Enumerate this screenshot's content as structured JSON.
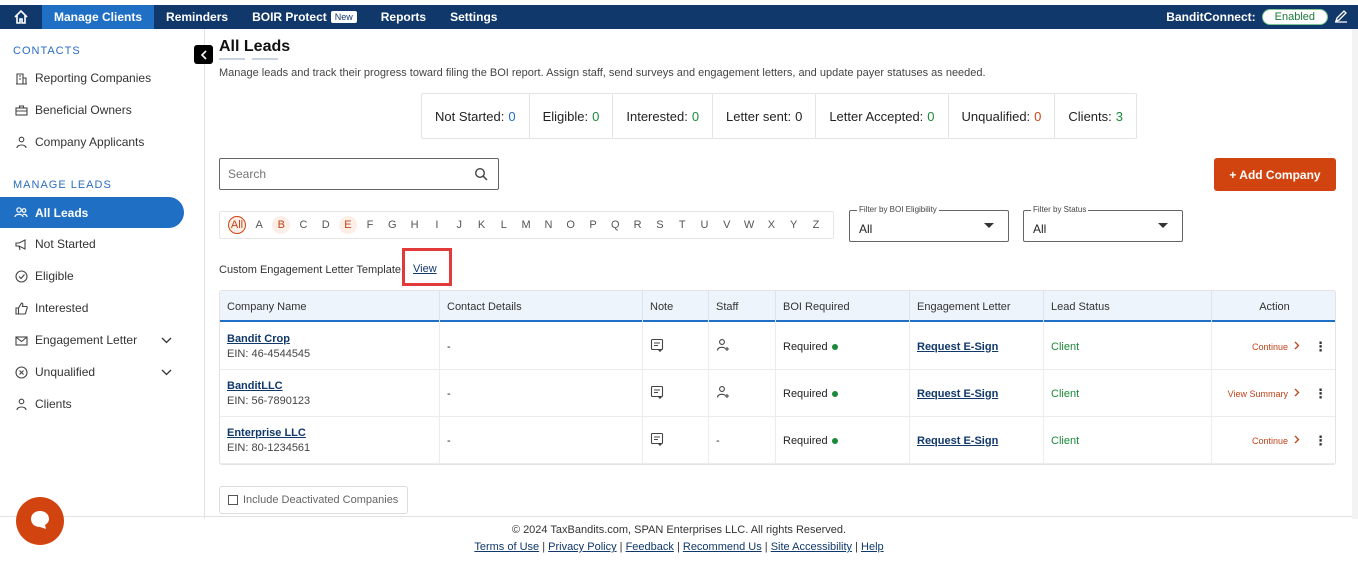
{
  "topnav": {
    "items": [
      "Manage Clients",
      "Reminders",
      "BOIR Protect",
      "Reports",
      "Settings"
    ],
    "new_badge": "New",
    "bandit_label": "BanditConnect:",
    "bandit_status": "Enabled"
  },
  "sidebar": {
    "contacts_header": "CONTACTS",
    "contacts": [
      "Reporting Companies",
      "Beneficial Owners",
      "Company Applicants"
    ],
    "leads_header": "MANAGE LEADS",
    "leads": [
      "All Leads",
      "Not Started",
      "Eligible",
      "Interested",
      "Engagement Letter",
      "Unqualified",
      "Clients"
    ]
  },
  "page": {
    "title": "All Leads",
    "subtitle": "Manage leads and track their progress toward filing the BOI report. Assign staff, send surveys and engagement letters, and update payer statuses as needed."
  },
  "stats": [
    {
      "label": "Not Started:",
      "value": "0",
      "color": "blue"
    },
    {
      "label": "Eligible:",
      "value": "0",
      "color": "green"
    },
    {
      "label": "Interested:",
      "value": "0",
      "color": "green"
    },
    {
      "label": "Letter sent:",
      "value": "0",
      "color": "none"
    },
    {
      "label": "Letter Accepted:",
      "value": "0",
      "color": "green"
    },
    {
      "label": "Unqualified:",
      "value": "0",
      "color": "red"
    },
    {
      "label": "Clients:",
      "value": "3",
      "color": "green"
    }
  ],
  "search": {
    "placeholder": "Search"
  },
  "add_button": "+ Add Company",
  "alphabet": [
    "All",
    "A",
    "B",
    "C",
    "D",
    "E",
    "F",
    "G",
    "H",
    "I",
    "J",
    "K",
    "L",
    "M",
    "N",
    "O",
    "P",
    "Q",
    "R",
    "S",
    "T",
    "U",
    "V",
    "W",
    "X",
    "Y",
    "Z"
  ],
  "filters": {
    "boi": {
      "label": "Filter by BOI Eligibility",
      "value": "All"
    },
    "status": {
      "label": "Filter by Status",
      "value": "All"
    }
  },
  "template": {
    "text": "Custom Engagement Letter Template",
    "link": "View"
  },
  "table": {
    "headers": [
      "Company Name",
      "Contact Details",
      "Note",
      "Staff",
      "BOI Required",
      "Engagement Letter",
      "Lead Status",
      "Action"
    ],
    "rows": [
      {
        "company": "Bandit Crop",
        "ein": "EIN: 46-4544545",
        "contact": "-",
        "staff": "",
        "boi": "Required",
        "letter": "Request E-Sign",
        "status": "Client",
        "action": "Continue"
      },
      {
        "company": "BanditLLC",
        "ein": "EIN: 56-7890123",
        "contact": "-",
        "staff": "",
        "boi": "Required",
        "letter": "Request E-Sign",
        "status": "Client",
        "action": "View Summary"
      },
      {
        "company": "Enterprise LLC",
        "ein": "EIN: 80-1234561",
        "contact": "-",
        "staff": "-",
        "boi": "Required",
        "letter": "Request E-Sign",
        "status": "Client",
        "action": "Continue"
      }
    ]
  },
  "deactivated": "Include Deactivated Companies",
  "footer": {
    "copyright": "© 2024 TaxBandits.com, SPAN Enterprises LLC. All rights Reserved.",
    "links": [
      "Terms of Use",
      "Privacy Policy",
      "Feedback",
      "Recommend Us",
      "Site Accessibility",
      "Help"
    ]
  },
  "colors": {
    "nav": "#11386b",
    "accent": "#1f6fc5",
    "orange": "#d2440f",
    "green": "#1a8a3a"
  }
}
